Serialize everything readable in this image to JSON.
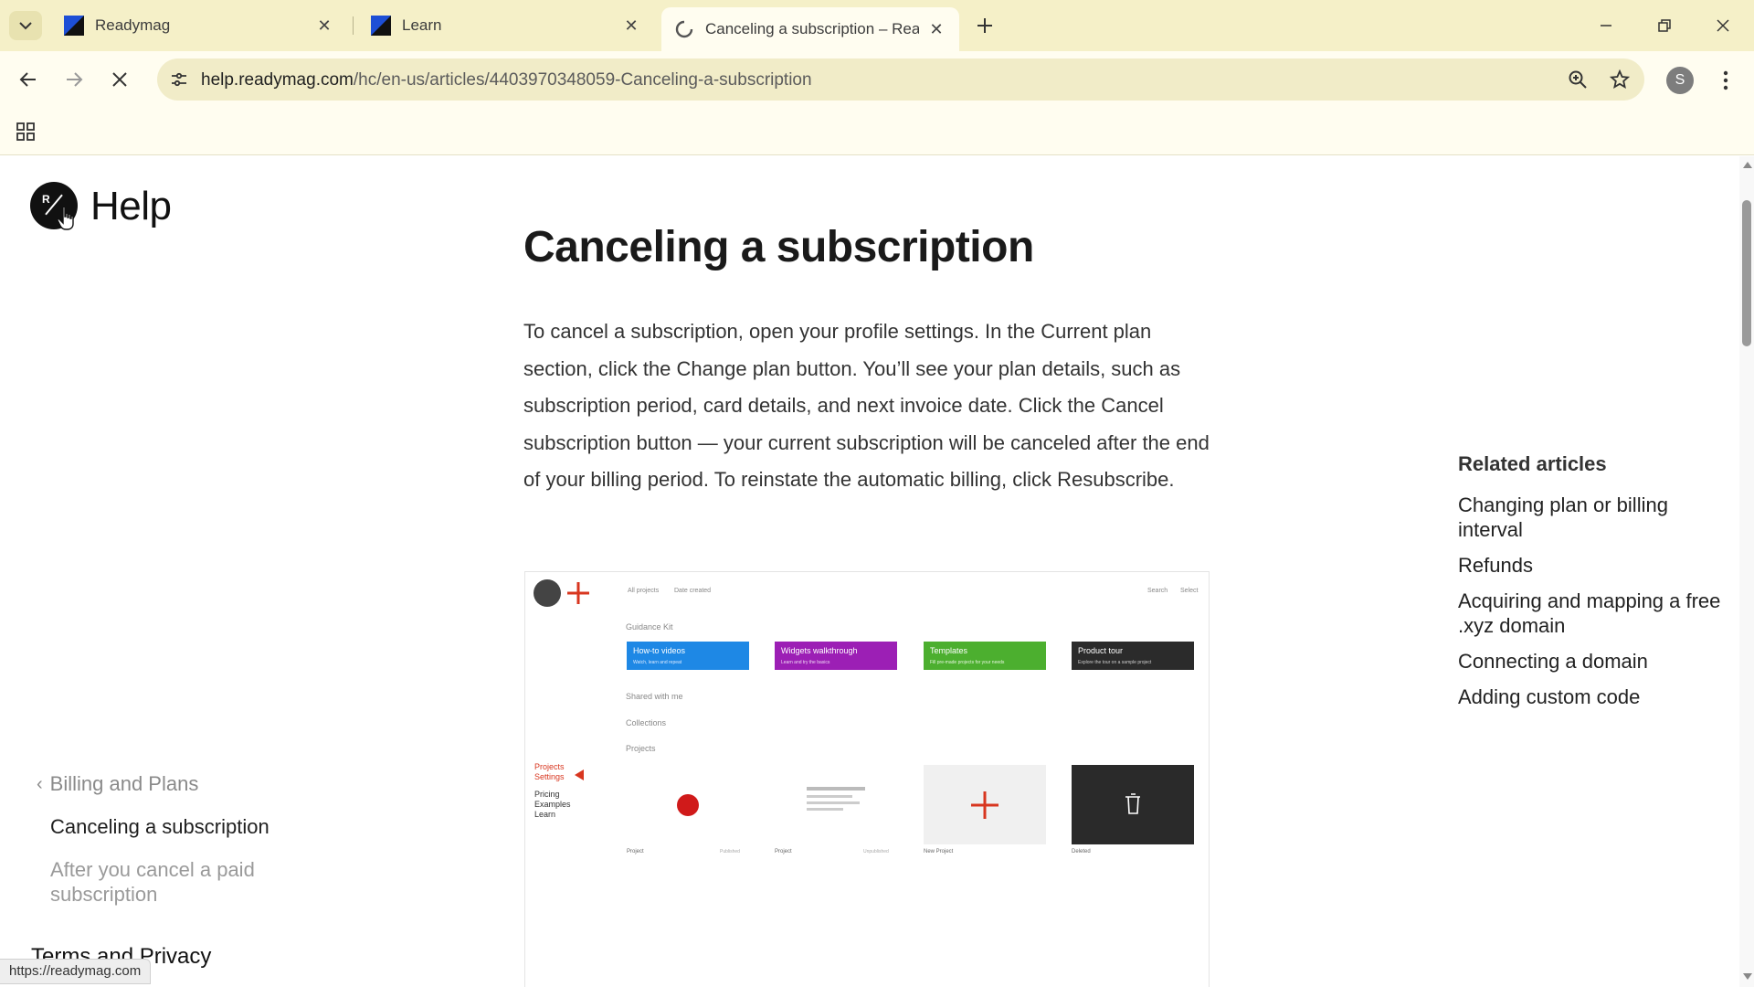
{
  "browser": {
    "tabs": [
      {
        "title": "Readymag",
        "favicon": "readymag-logo-icon",
        "active": false
      },
      {
        "title": "Learn",
        "favicon": "readymag-logo-icon",
        "active": false
      },
      {
        "title": "Canceling a subscription – Reac",
        "favicon": "loading-spinner-icon",
        "active": true
      }
    ],
    "url_host": "help.readymag.com",
    "url_path": "/hc/en-us/articles/4403970348059-Canceling-a-subscription",
    "profile_initial": "S"
  },
  "site": {
    "help_title": "Help",
    "logo_letter": "R"
  },
  "article": {
    "title": "Canceling a subscription",
    "body": "To cancel a subscription, open your profile settings. In the Current plan section, click the Change plan button. You’ll see your plan details, such as subscription period, card details, and next invoice date. Click the Cancel subscription button — your current subscription will be canceled after the end of your billing period. To reinstate the automatic billing, click Resubscribe."
  },
  "screenshot": {
    "top_links": [
      "All projects",
      "Date created"
    ],
    "top_right": [
      "Search",
      "Select"
    ],
    "guidance_label": "Guidance Kit",
    "cards": [
      {
        "title": "How-to videos",
        "sub": "Watch, learn and repeat",
        "color": "#1e88e5"
      },
      {
        "title": "Widgets walkthrough",
        "sub": "Learn and try the basics",
        "color": "#9c1fb5"
      },
      {
        "title": "Templates",
        "sub": "Fill pre-made projects for your needs",
        "color": "#4caf2f"
      },
      {
        "title": "Product tour",
        "sub": "Explore the tour on a sample project",
        "color": "#2b2b2b"
      }
    ],
    "sections": [
      "Shared with me",
      "Collections",
      "Projects"
    ],
    "left_menu_red": [
      "Projects",
      "Settings"
    ],
    "left_menu": [
      "Pricing",
      "Examples",
      "Learn"
    ],
    "project_labels": [
      "Project",
      "Project",
      "New Project",
      "Deleted"
    ],
    "project_meta": [
      "Published",
      "Unpublished"
    ]
  },
  "sidebar": {
    "back_label": "Billing and Plans",
    "items": [
      {
        "label": "Canceling a subscription",
        "current": true
      },
      {
        "label": "After you cancel a paid subscription",
        "current": false
      }
    ],
    "terms": "Terms and Privacy"
  },
  "related": {
    "heading": "Related articles",
    "items": [
      "Changing plan or billing interval",
      "Refunds",
      "Acquiring and mapping a free .xyz domain",
      "Connecting a domain",
      "Adding custom code"
    ]
  },
  "status_url": "https://readymag.com"
}
